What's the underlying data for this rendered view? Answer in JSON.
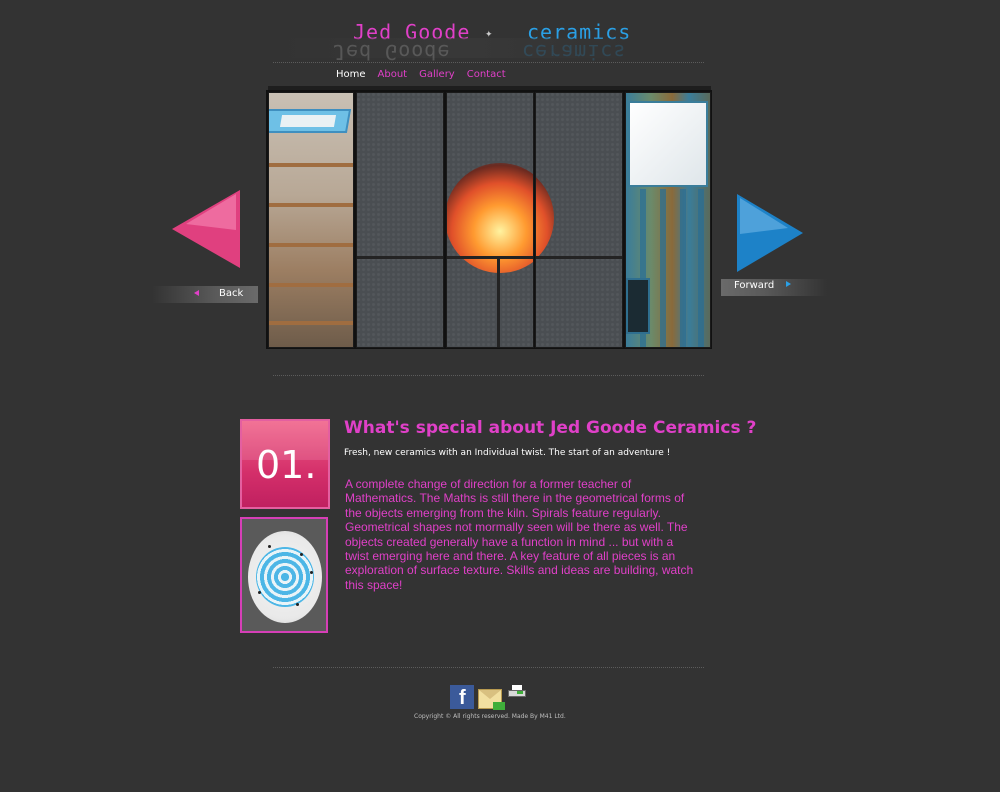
{
  "logo": {
    "part1": "Jed Goode",
    "part2": "ceramics"
  },
  "nav": {
    "items": [
      {
        "label": "Home",
        "active": true
      },
      {
        "label": "About"
      },
      {
        "label": "Gallery"
      },
      {
        "label": "Contact"
      }
    ]
  },
  "slider": {
    "back_label": "Back",
    "forward_label": "Forward"
  },
  "content": {
    "number": "01.",
    "headline": "What's special about Jed Goode Ceramics ?",
    "subline": "Fresh, new ceramics with an Individual twist. The start of an adventure !",
    "body": "A complete change of direction for a former teacher of Mathematics. The Maths is still there in the geometrical forms of the objects emerging from the kiln. Spirals feature regularly. Geometrical shapes not mormally seen will be there as well. The objects created generally have a function in mind ... but with a twist emerging here and there. A key feature of all pieces is an exploration of surface texture. Skills and ideas are building, watch this space!"
  },
  "footer": {
    "icons": [
      "facebook-icon",
      "mail-icon",
      "print-icon"
    ],
    "copyright": "Copyright © All rights reserved. Made By M41 Ltd."
  },
  "colors": {
    "background": "#333333",
    "accent_pink": "#e040c8",
    "accent_blue": "#2aa0e6"
  }
}
